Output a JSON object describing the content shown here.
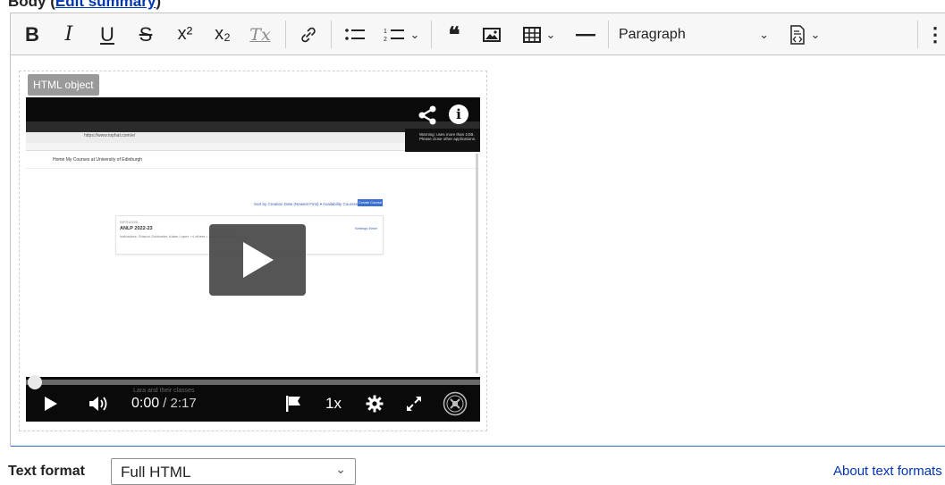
{
  "field": {
    "label": "Body",
    "summary_link": "Edit summary"
  },
  "toolbar": {
    "bold": "B",
    "italic": "I",
    "underline": "U",
    "strike": "S",
    "superscript": "x²",
    "subscript": "x₂",
    "remove_format": "Tx",
    "format_select": "Paragraph"
  },
  "embed": {
    "label": "HTML object",
    "screenshot": {
      "url": "https://www.tophat.com/e/",
      "app_title": "Home  My Courses at University of Edinburgh",
      "notice": "Warning: uses more than 1GB. Please close other applications.",
      "sort_text": "Sort by Creation Date (Newest First)  ▾   Availability Courses (1)  ▾",
      "create_button": "Create Course",
      "card_code": "INFR11155",
      "card_title": "ANLP 2022-23",
      "card_meta": "Instructors: Sharon Goldwater, Adam Lopez +4 others  •  Join Code: 223635",
      "card_actions": "Settings   Enter",
      "caption": "Lara and their classes"
    },
    "player": {
      "current_time": "0:00",
      "duration": "/ 2:17",
      "speed": "1x",
      "progress": 0
    }
  },
  "text_format": {
    "label": "Text format",
    "selected": "Full HTML",
    "about_link": "About text formats"
  }
}
